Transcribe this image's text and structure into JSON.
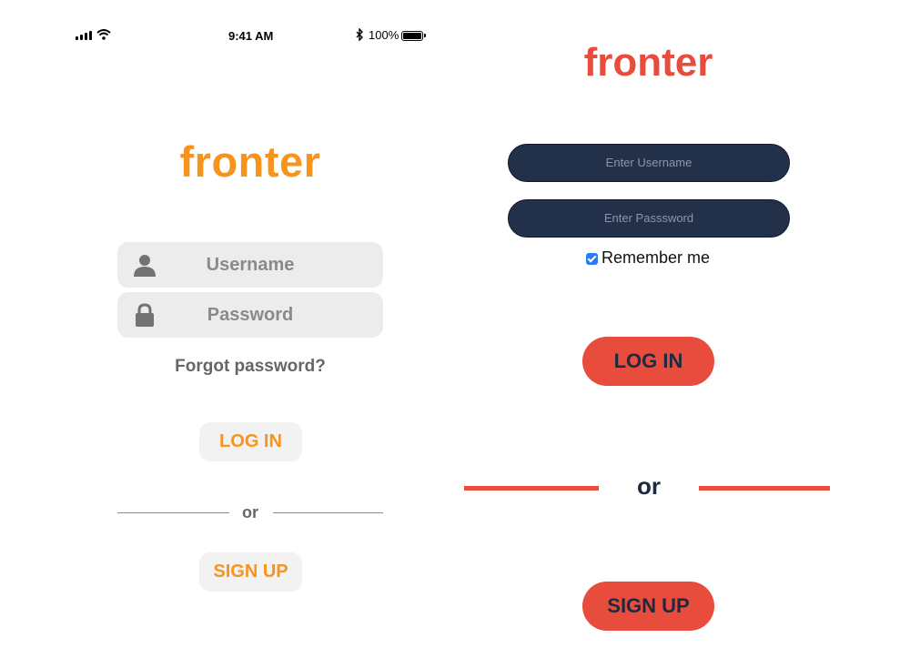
{
  "left_screen": {
    "status_bar": {
      "time": "9:41 AM",
      "battery_text": "100%",
      "battery_level_percent": 100,
      "icons": [
        "signal-icon",
        "wifi-icon",
        "bluetooth-icon",
        "battery-icon"
      ]
    },
    "logo": "fronter",
    "username_field": {
      "placeholder": "Username",
      "icon": "user-icon"
    },
    "password_field": {
      "placeholder": "Password",
      "icon": "lock-icon"
    },
    "forgot_password": "Forgot password?",
    "login_button": "LOG IN",
    "divider_text": "or",
    "signup_button": "SIGN UP",
    "colors": {
      "accent": "#f7941d",
      "field_bg": "#ececec",
      "text_gray": "#666666"
    }
  },
  "right_screen": {
    "logo": "fronter",
    "username_input": {
      "placeholder": "Enter Username"
    },
    "password_input": {
      "placeholder": "Enter Passsword"
    },
    "remember_me": {
      "label": "Remember me",
      "checked": true
    },
    "login_button": "LOG IN",
    "divider_text": "or",
    "signup_button": "SIGN UP",
    "colors": {
      "accent": "#e84c3d",
      "input_bg": "#22304a",
      "button_text": "#1d2a40"
    }
  }
}
